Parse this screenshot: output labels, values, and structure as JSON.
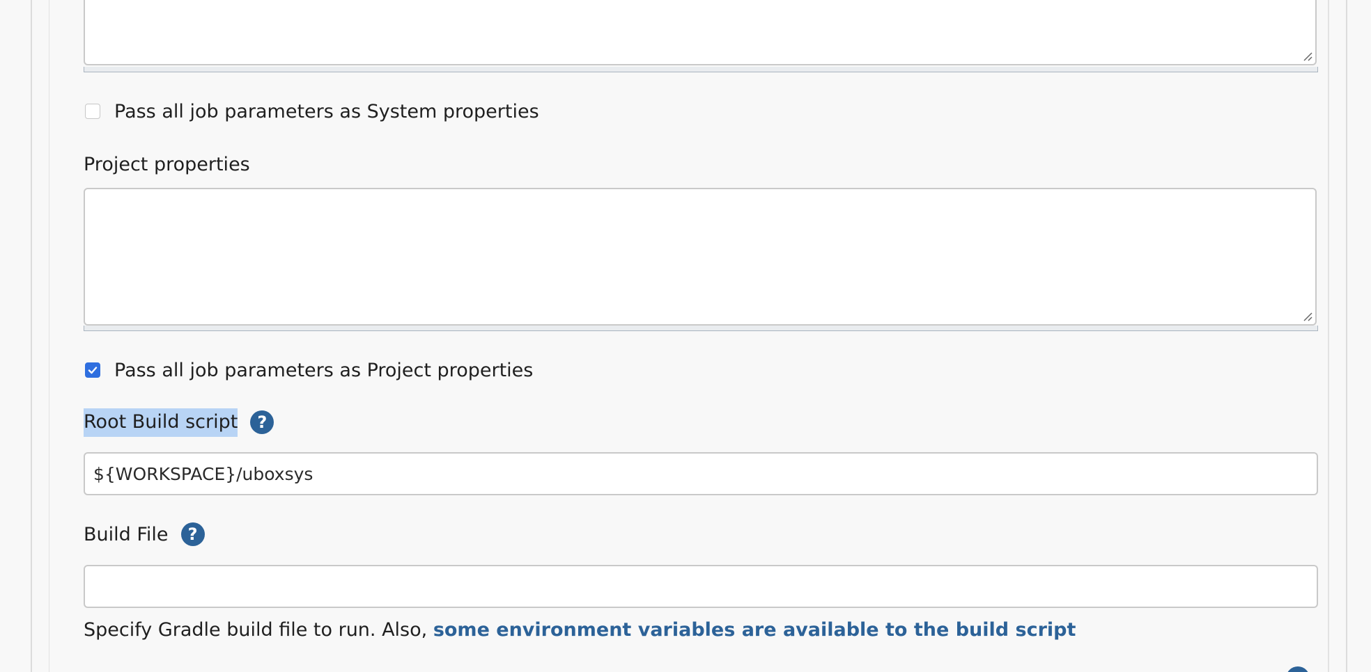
{
  "system_properties": {
    "checkbox_label": "Pass all job parameters as System properties",
    "checked": false
  },
  "project_properties": {
    "label": "Project properties",
    "value": "",
    "checkbox_label": "Pass all job parameters as Project properties",
    "checked": true
  },
  "root_build_script": {
    "label": "Root Build script",
    "help_icon": "?",
    "value": "${WORKSPACE}/uboxsys"
  },
  "build_file": {
    "label": "Build File",
    "help_icon": "?",
    "value": "",
    "help_text": "Specify Gradle build file to run. Also, ",
    "help_link": "some environment variables are available to the build script"
  },
  "colors": {
    "accent_blue": "#2c6298",
    "checkbox_blue": "#2f6fdf",
    "label_highlight": "#b8d4f5",
    "background": "#f8f8f8"
  }
}
